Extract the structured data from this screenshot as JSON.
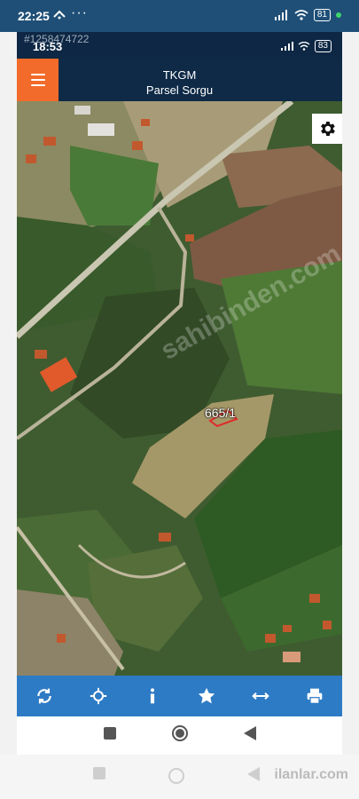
{
  "status_bar": {
    "time": "22:25",
    "battery": "81",
    "colors": {
      "background": "#1f4f77",
      "dot": "#3fd46f"
    }
  },
  "inner_status": {
    "watermark": "#1258474722",
    "time": "18:53",
    "battery": "83"
  },
  "app": {
    "title_line1": "TKGM",
    "title_line2": "Parsel Sorgu",
    "accent_color": "#f26b2a",
    "toolbar_color": "#2d7bc5"
  },
  "map": {
    "parcel_label": "665/1",
    "watermark_text": "sahibinden.com"
  },
  "toolbar": {
    "icons": [
      "refresh-icon",
      "locate-icon",
      "info-icon",
      "star-icon",
      "measure-icon",
      "print-icon"
    ]
  },
  "nav": {
    "icons": [
      "recent-apps-icon",
      "home-icon",
      "back-icon"
    ]
  },
  "footer": {
    "watermark": "ilanlar.com"
  }
}
